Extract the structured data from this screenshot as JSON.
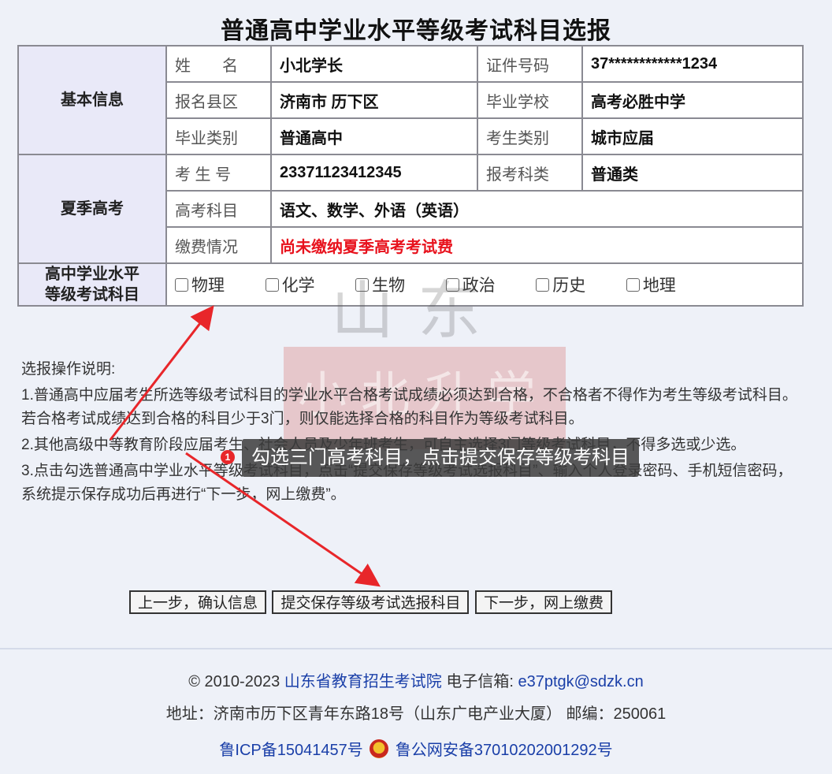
{
  "page": {
    "title": "普通高中学业水平等级考试科目选报"
  },
  "basic_info": {
    "section": "基本信息",
    "name_label": "姓　　名",
    "name_value": "小北学长",
    "id_label": "证件号码",
    "id_value": "37************1234",
    "county_label": "报名县区",
    "county_value": "济南市 历下区",
    "school_label": "毕业学校",
    "school_value": "高考必胜中学",
    "grad_type_label": "毕业类别",
    "grad_type_value": "普通高中",
    "exam_type_label": "考生类别",
    "exam_type_value": "城市应届"
  },
  "summer_exam": {
    "section": "夏季高考",
    "exam_no_label": "考 生 号",
    "exam_no_value": "23371123412345",
    "category_label": "报考科类",
    "category_value": "普通类",
    "subjects_label": "高考科目",
    "subjects_value": "语文、数学、外语（英语）",
    "fee_label": "缴费情况",
    "fee_value": "尚未缴纳夏季高考考试费"
  },
  "level_exam": {
    "section_line1": "高中学业水平",
    "section_line2": "等级考试科目",
    "subjects": [
      "物理",
      "化学",
      "生物",
      "政治",
      "历史",
      "地理"
    ]
  },
  "instructions": {
    "heading": "选报操作说明:",
    "items": [
      "1.普通高中应届考生所选等级考试科目的学业水平合格考试成绩必须达到合格，不合格者不得作为考生等级考试科目。若合格考试成绩达到合格的科目少于3门，则仅能选择合格的科目作为等级考试科目。",
      "2.其他高级中等教育阶段应届考生、社会人员及少年班考生，可自主选择3门等级考试科目，不得多选或少选。",
      "3.点击勾选普通高中学业水平等级考试科目，点击“提交保存等级考试选报科目”、输入个人登录密码、手机短信密码，系统提示保存成功后再进行“下一步，网上缴费”。"
    ]
  },
  "buttons": {
    "prev": "上一步，确认信息",
    "submit": "提交保存等级考试选报科目",
    "next": "下一步，网上缴费"
  },
  "annotation": {
    "number": "1",
    "text": "勾选三门高考科目，点击提交保存等级考科目"
  },
  "footer": {
    "copyright_prefix": "© 2010-2023",
    "org_link": "山东省教育招生考试院",
    "email_label": "电子信箱:",
    "email": "e37ptgk@sdzk.cn",
    "address": "地址：济南市历下区青年东路18号（山东广电产业大厦） 邮编：250061",
    "icp": "鲁ICP备15041457号",
    "police": "鲁公网安备37010202001292号"
  },
  "watermark": {
    "text1": "山东",
    "text2": "小北升学"
  },
  "colors": {
    "background": "#eef1f8",
    "section_bg": "#e9e9f8",
    "alert": "#e8121d",
    "link": "#1a3fa8",
    "arrow": "#e8262a"
  }
}
